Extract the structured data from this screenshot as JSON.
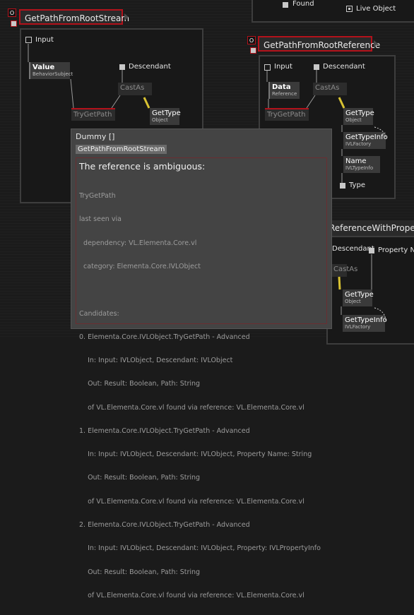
{
  "colors": {
    "accent_red": "#b3121b",
    "tooltip_bg": "#444444",
    "node_bg": "#3a3a3a",
    "link_yellow": "#d8c232"
  },
  "top_right": {
    "found": "Found",
    "live_object": "Live Object"
  },
  "left_region": {
    "o_label": "O",
    "title": "GetPathFromRootStream",
    "input_label": "Input",
    "descendant_label": "Descendant",
    "value_node": {
      "title": "Value",
      "type": "BehaviorSubject"
    },
    "castas": "CastAs",
    "trygetpath": "TryGetPath",
    "gettype_node": {
      "title": "GetType",
      "type": "Object"
    }
  },
  "right_region": {
    "o_label": "O",
    "title": "GetPathFromRootReference",
    "input_label": "Input",
    "descendant_label": "Descendant",
    "data_node": {
      "title": "Data",
      "type": "Reference"
    },
    "castas": "CastAs",
    "trygetpath": "TryGetPath",
    "gettype_node": {
      "title": "GetType",
      "type": "Object"
    },
    "gettypeinfo_node": {
      "title": "GetTypeInfo",
      "type": "IVLFactory"
    },
    "name_node": {
      "title": "Name",
      "type": "IVLTypeInfo"
    },
    "type_label": "Type"
  },
  "bottom_right_region": {
    "title_partial": "ReferenceWithProperty",
    "descendant_label": "Descendant",
    "property_label": "Property Na",
    "castas": "CastAs",
    "gettype_node": {
      "title": "GetType",
      "type": "Object"
    },
    "gettypeinfo_node": {
      "title": "GetTypeInfo",
      "type": "IVLFactory"
    }
  },
  "tooltip": {
    "title": "Dummy []",
    "tag": "GetPathFromRootStream",
    "heading": "The reference is ambiguous:",
    "lines": [
      "TryGetPath",
      "last seen via",
      "  dependency: VL.Elementa.Core.vl",
      "  category: Elementa.Core.IVLObject",
      "",
      "Candidates:",
      "0. Elementa.Core.IVLObject.TryGetPath - Advanced",
      "    In: Input: IVLObject, Descendant: IVLObject",
      "    Out: Result: Boolean, Path: String",
      "    of VL.Elementa.Core.vl found via reference: VL.Elementa.Core.vl",
      "1. Elementa.Core.IVLObject.TryGetPath - Advanced",
      "    In: Input: IVLObject, Descendant: IVLObject, Property Name: String",
      "    Out: Result: Boolean, Path: String",
      "    of VL.Elementa.Core.vl found via reference: VL.Elementa.Core.vl",
      "2. Elementa.Core.IVLObject.TryGetPath - Advanced",
      "    In: Input: IVLObject, Descendant: IVLObject, Property: IVLPropertyInfo",
      "    Out: Result: Boolean, Path: String",
      "    of VL.Elementa.Core.vl found via reference: VL.Elementa.Core.vl"
    ]
  }
}
